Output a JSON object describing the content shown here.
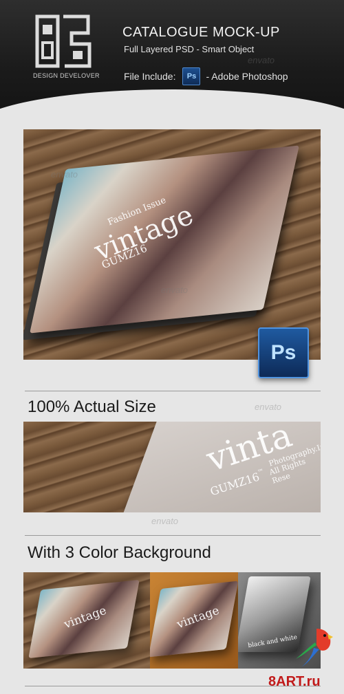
{
  "header": {
    "logo_caption": "DESIGN DEVELOVER",
    "title": "CATALOGUE MOCK-UP",
    "subtitle": "Full Layered PSD - Smart Object",
    "file_label": "File Include:",
    "ps_icon_text": "Ps",
    "file_app": "- Adobe Photoshop"
  },
  "hero": {
    "cover_line1": "Fashion Issue",
    "cover_title": "vintage",
    "cover_brand": "GUMZ16",
    "ps_badge": "Ps"
  },
  "section_actual": {
    "title": "100% Actual Size",
    "cover_title": "vinta",
    "cover_brand": "GUMZ16",
    "cover_tm": "™",
    "cover_line": "Photography.In",
    "cover_rights": "All Rights Rese"
  },
  "section_colors": {
    "title": "With 3 Color Background",
    "thumb1_title": "vintage",
    "thumb2_title": "vintage",
    "thumb3_title": "black and white"
  },
  "watermark": "envato",
  "site_mark": "8ART.ru",
  "colors": {
    "site_red": "#c11a1a",
    "ps_blue": "#1f5aa0"
  }
}
